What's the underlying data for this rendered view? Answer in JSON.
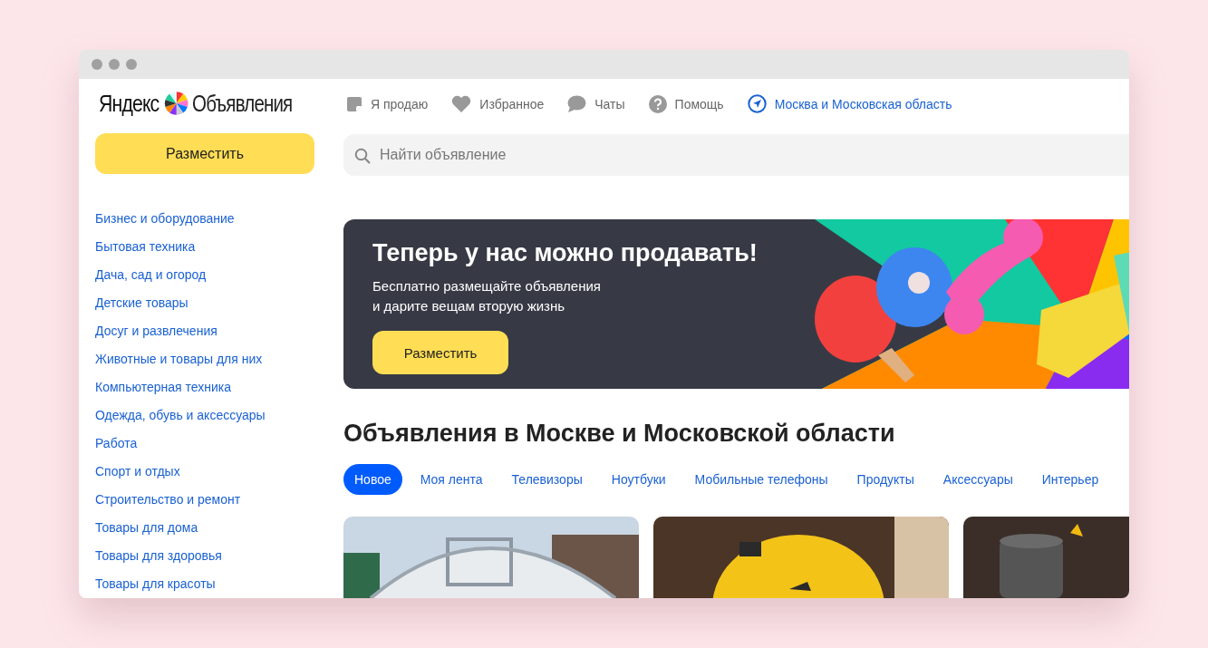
{
  "logo": {
    "brand": "Яндекс",
    "service": "Объявления"
  },
  "nav": [
    {
      "kind": "note",
      "label": "Я продаю"
    },
    {
      "kind": "heart",
      "label": "Избранное"
    },
    {
      "kind": "chat",
      "label": "Чаты"
    },
    {
      "kind": "help",
      "label": "Помощь"
    },
    {
      "kind": "location",
      "label": "Москва и Московская область"
    }
  ],
  "post_button": "Разместить",
  "search": {
    "placeholder": "Найти объявление"
  },
  "categories": [
    "Бизнес и оборудование",
    "Бытовая техника",
    "Дача, сад и огород",
    "Детские товары",
    "Досуг и развлечения",
    "Животные и товары для них",
    "Компьютерная техника",
    "Одежда, обувь и аксессуары",
    "Работа",
    "Спорт и отдых",
    "Строительство и ремонт",
    "Товары для дома",
    "Товары для здоровья",
    "Товары для красоты"
  ],
  "banner": {
    "title": "Теперь у нас можно продавать!",
    "text_lines": [
      "Бесплатно размещайте объявления",
      "и дарите вещам вторую жизнь"
    ],
    "button": "Разместить",
    "art": {
      "kind": "picture"
    }
  },
  "section_title": "Объявления в Москве и Московской области",
  "chips": [
    {
      "label": "Новое",
      "selected": true
    },
    {
      "label": "Моя лента",
      "selected": false
    },
    {
      "label": "Телевизоры",
      "selected": false
    },
    {
      "label": "Ноутбуки",
      "selected": false
    },
    {
      "label": "Мобильные телефоны",
      "selected": false
    },
    {
      "label": "Продукты",
      "selected": false
    },
    {
      "label": "Аксессуары",
      "selected": false
    },
    {
      "label": "Интерьер",
      "selected": false
    }
  ],
  "listings": [
    {
      "kind": "picture"
    },
    {
      "kind": "picture"
    },
    {
      "kind": "picture"
    }
  ]
}
